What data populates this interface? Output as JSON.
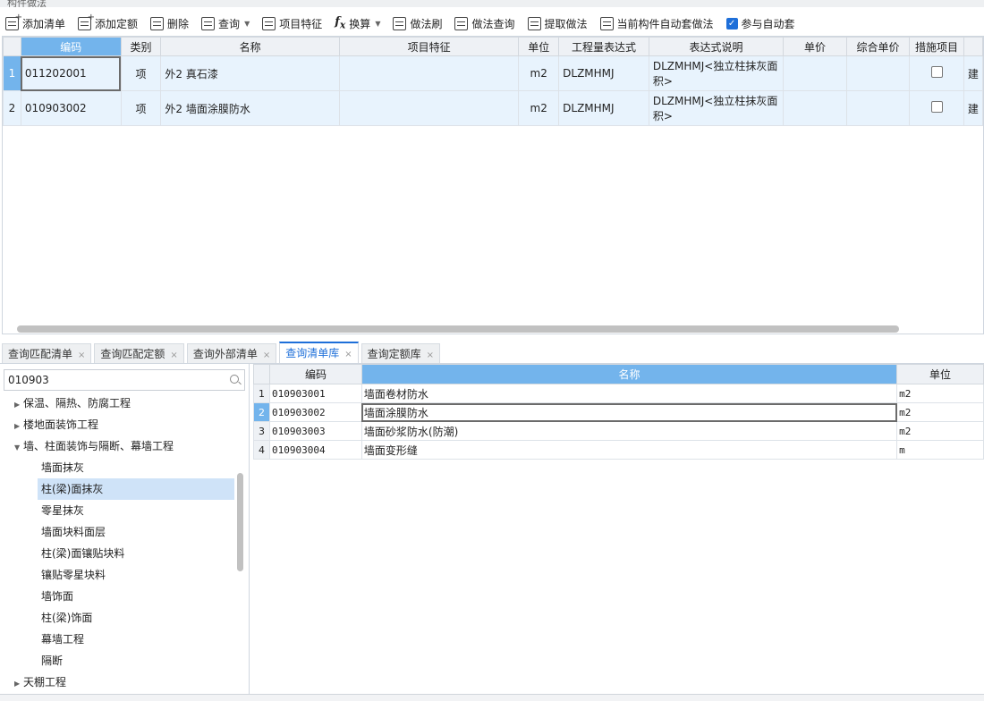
{
  "panel": {
    "title": "构件做法"
  },
  "toolbar": {
    "add_list": "添加清单",
    "add_quota": "添加定额",
    "delete": "删除",
    "query": "查询",
    "item_features": "项目特征",
    "convert": "换算",
    "method_brush": "做法刷",
    "method_query": "做法查询",
    "extract_method": "提取做法",
    "auto_method": "当前构件自动套做法",
    "auto_join": "参与自动套",
    "auto_join_checked": true
  },
  "top_grid": {
    "columns": [
      "编码",
      "类别",
      "名称",
      "项目特征",
      "单位",
      "工程量表达式",
      "表达式说明",
      "单价",
      "综合单价",
      "措施项目",
      ""
    ],
    "rows": [
      {
        "no": "1",
        "code": "011202001",
        "type": "项",
        "name": "外2 真石漆",
        "features": "",
        "unit": "m2",
        "expr": "DLZMHMJ",
        "expr_desc": "DLZMHMJ<独立柱抹灰面积>",
        "price": "",
        "total_price": "",
        "measure": false,
        "extra": "建"
      },
      {
        "no": "2",
        "code": "010903002",
        "type": "项",
        "name": "外2 墙面涂膜防水",
        "features": "",
        "unit": "m2",
        "expr": "DLZMHMJ",
        "expr_desc": "DLZMHMJ<独立柱抹灰面积>",
        "price": "",
        "total_price": "",
        "measure": false,
        "extra": "建"
      }
    ]
  },
  "tabs": [
    {
      "label": "查询匹配清单",
      "active": false
    },
    {
      "label": "查询匹配定额",
      "active": false
    },
    {
      "label": "查询外部清单",
      "active": false
    },
    {
      "label": "查询清单库",
      "active": true
    },
    {
      "label": "查询定额库",
      "active": false
    }
  ],
  "search": {
    "value": "010903"
  },
  "tree": [
    {
      "label": "保温、隔热、防腐工程",
      "level": 0,
      "expanded": false
    },
    {
      "label": "楼地面装饰工程",
      "level": 0,
      "expanded": false
    },
    {
      "label": "墙、柱面装饰与隔断、幕墙工程",
      "level": 0,
      "expanded": true
    },
    {
      "label": "墙面抹灰",
      "level": 1
    },
    {
      "label": "柱(梁)面抹灰",
      "level": 1,
      "selected": true
    },
    {
      "label": "零星抹灰",
      "level": 1
    },
    {
      "label": "墙面块料面层",
      "level": 1
    },
    {
      "label": "柱(梁)面镶贴块料",
      "level": 1
    },
    {
      "label": "镶贴零星块料",
      "level": 1
    },
    {
      "label": "墙饰面",
      "level": 1
    },
    {
      "label": "柱(梁)饰面",
      "level": 1
    },
    {
      "label": "幕墙工程",
      "level": 1
    },
    {
      "label": "隔断",
      "level": 1
    },
    {
      "label": "天棚工程",
      "level": 0,
      "expanded": false
    }
  ],
  "result_grid": {
    "columns": [
      "编码",
      "名称",
      "单位"
    ],
    "rows": [
      {
        "no": "1",
        "code": "010903001",
        "name": "墙面卷材防水",
        "unit": "m2"
      },
      {
        "no": "2",
        "code": "010903002",
        "name": "墙面涂膜防水",
        "unit": "m2"
      },
      {
        "no": "3",
        "code": "010903003",
        "name": "墙面砂浆防水(防潮)",
        "unit": "m2"
      },
      {
        "no": "4",
        "code": "010903004",
        "name": "墙面变形缝",
        "unit": "m"
      }
    ]
  },
  "colors": {
    "accent": "#1e6fd9",
    "header_selected": "#73b4ec",
    "row_highlight": "#e8f3fd",
    "tree_selected": "#cfe3f8"
  }
}
